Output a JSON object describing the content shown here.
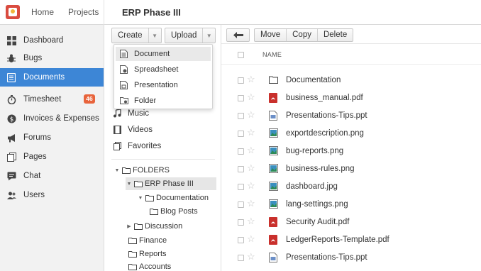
{
  "topbar": {
    "nav": [
      "Home",
      "Projects"
    ],
    "project_title": "ERP Phase III"
  },
  "sidebar": {
    "items": [
      {
        "label": "Dashboard",
        "icon": "dashboard-icon"
      },
      {
        "label": "Bugs",
        "icon": "bug-icon"
      },
      {
        "label": "Documents",
        "icon": "documents-icon",
        "active": true
      },
      {
        "label": "Timesheet",
        "icon": "stopwatch-icon",
        "badge": "46"
      },
      {
        "label": "Invoices & Expenses",
        "icon": "dollar-icon"
      },
      {
        "label": "Forums",
        "icon": "megaphone-icon"
      },
      {
        "label": "Pages",
        "icon": "pages-icon"
      },
      {
        "label": "Chat",
        "icon": "chat-icon"
      },
      {
        "label": "Users",
        "icon": "users-icon"
      }
    ]
  },
  "toolbar": {
    "create_label": "Create",
    "upload_label": "Upload",
    "move_label": "Move",
    "copy_label": "Copy",
    "delete_label": "Delete"
  },
  "create_menu": {
    "items": [
      {
        "label": "Document",
        "icon": "document-icon"
      },
      {
        "label": "Spreadsheet",
        "icon": "spreadsheet-icon"
      },
      {
        "label": "Presentation",
        "icon": "presentation-icon"
      },
      {
        "label": "Folder",
        "icon": "folder-icon"
      }
    ]
  },
  "categories": [
    {
      "label": "Music",
      "icon": "music-icon"
    },
    {
      "label": "Videos",
      "icon": "video-icon"
    },
    {
      "label": "Favorites",
      "icon": "favorites-icon"
    }
  ],
  "tree": {
    "root": "FOLDERS",
    "nodes": [
      {
        "label": "ERP Phase III",
        "selected": true
      },
      {
        "label": "Documentation"
      },
      {
        "label": "Blog Posts"
      },
      {
        "label": "Discussion"
      },
      {
        "label": "Finance"
      },
      {
        "label": "Reports"
      },
      {
        "label": "Accounts"
      }
    ]
  },
  "list": {
    "name_header": "NAME",
    "files": [
      {
        "name": "Documentation",
        "type": "folder"
      },
      {
        "name": "business_manual.pdf",
        "type": "pdf"
      },
      {
        "name": "Presentations-Tips.ppt",
        "type": "ppt"
      },
      {
        "name": "exportdescription.png",
        "type": "image"
      },
      {
        "name": "bug-reports.png",
        "type": "image"
      },
      {
        "name": "business-rules.png",
        "type": "image"
      },
      {
        "name": "dashboard.jpg",
        "type": "image"
      },
      {
        "name": "lang-settings.png",
        "type": "image"
      },
      {
        "name": "Security Audit.pdf",
        "type": "pdf"
      },
      {
        "name": "LedgerReports-Template.pdf",
        "type": "pdf"
      },
      {
        "name": "Presentations-Tips.ppt",
        "type": "ppt"
      }
    ]
  },
  "colors": {
    "accent": "#3d86d6",
    "badge": "#e8643c",
    "pdf": "#c9302c",
    "image": "#2e8b57"
  }
}
